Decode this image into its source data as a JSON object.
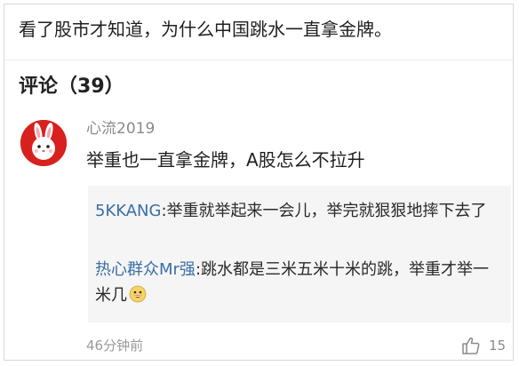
{
  "post": {
    "title": "看了股市才知道，为什么中国跳水一直拿金牌。"
  },
  "comments_section": {
    "label": "评论",
    "count": "（39）"
  },
  "comment": {
    "username": "心流2019",
    "text": "举重也一直拿金牌，A股怎么不拉升",
    "timestamp": "46分钟前",
    "like_count": "15",
    "avatar_icon": "rabbit-avatar-icon",
    "like_icon": "thumbs-up-icon",
    "replies": [
      {
        "author": "5KKANG",
        "text": ":举重就举起来一会儿，举完就狠狠地摔下去了"
      },
      {
        "author": "热心群众Mr强",
        "text": ":跳水都是三米五米十米的跳，举重才举一米几",
        "emoji_icon": "grinning-emoji-icon"
      }
    ]
  },
  "colors": {
    "reply_author": "#3a6ea5",
    "avatar_background": "#d8201f",
    "reply_background": "#f5f5f5",
    "muted_text": "#8a8a8a"
  }
}
